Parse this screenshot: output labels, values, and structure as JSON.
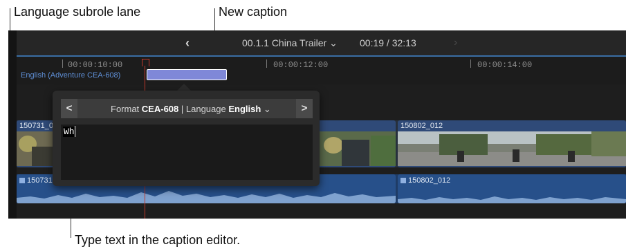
{
  "callouts": {
    "language_subrole_lane": "Language subrole lane",
    "new_caption": "New caption",
    "type_text": "Type text in the caption editor."
  },
  "toolbar": {
    "back_icon": "chevron-left-icon",
    "forward_icon": "chevron-right-icon",
    "project_name": "00.1.1 China Trailer ⌄",
    "timecode": "00:19 / 32:13"
  },
  "ruler": {
    "timecodes": [
      "00:00:10:00",
      "00:00:12:00",
      "00:00:14:00"
    ]
  },
  "caption_lane": {
    "label": "English (Adventure CEA-608)"
  },
  "caption_editor": {
    "prev_label": "<",
    "next_label": ">",
    "format_prefix": "Format",
    "format_value": "CEA-608",
    "separator": " | ",
    "language_prefix": "Language",
    "language_value": "English",
    "dropdown_icon": "⌄",
    "text": "Wh"
  },
  "video_clips": [
    {
      "name": "150731_0"
    },
    {
      "name": "150802_012"
    }
  ],
  "audio_clips": [
    {
      "name": "150731"
    },
    {
      "name": "150802_012"
    }
  ],
  "colors": {
    "caption_clip": "#7f88d8",
    "lane_label": "#5f8fd6",
    "playhead": "#c0392b",
    "clip_blue": "#2f4a78"
  }
}
